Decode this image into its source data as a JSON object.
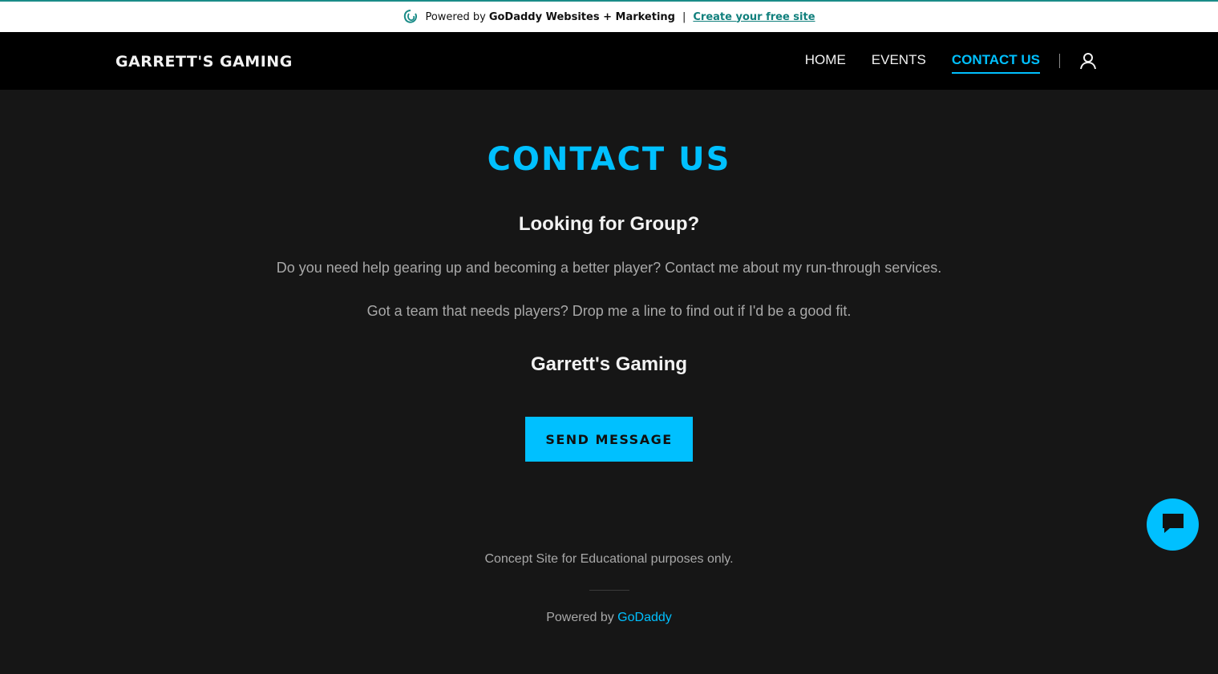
{
  "promo": {
    "powered_text": "Powered by",
    "brand_text": "GoDaddy Websites + Marketing",
    "separator": "|",
    "cta_text": "Create your free site",
    "icon": "godaddy-logo-icon"
  },
  "header": {
    "site_title": "GARRETT'S GAMING",
    "nav": [
      {
        "label": "HOME",
        "active": false
      },
      {
        "label": "EVENTS",
        "active": false
      },
      {
        "label": "CONTACT US",
        "active": true
      }
    ],
    "account_icon": "user-icon"
  },
  "main": {
    "title": "CONTACT US",
    "subheading": "Looking for Group?",
    "paragraph_1": "Do you need help gearing up and becoming a better player? Contact me about my run-through services.",
    "paragraph_2": "Got a team that needs players? Drop me a line to find out if I'd be a good fit.",
    "business_name": "Garrett's Gaming",
    "send_button": "SEND MESSAGE"
  },
  "footer": {
    "note": "Concept Site for Educational purposes only.",
    "powered_prefix": "Powered by",
    "powered_link": "GoDaddy"
  },
  "chat": {
    "icon": "chat-icon"
  },
  "colors": {
    "accent": "#00c0ff",
    "background": "#161616",
    "header_bg": "#000000",
    "promo_link": "#11807d"
  }
}
